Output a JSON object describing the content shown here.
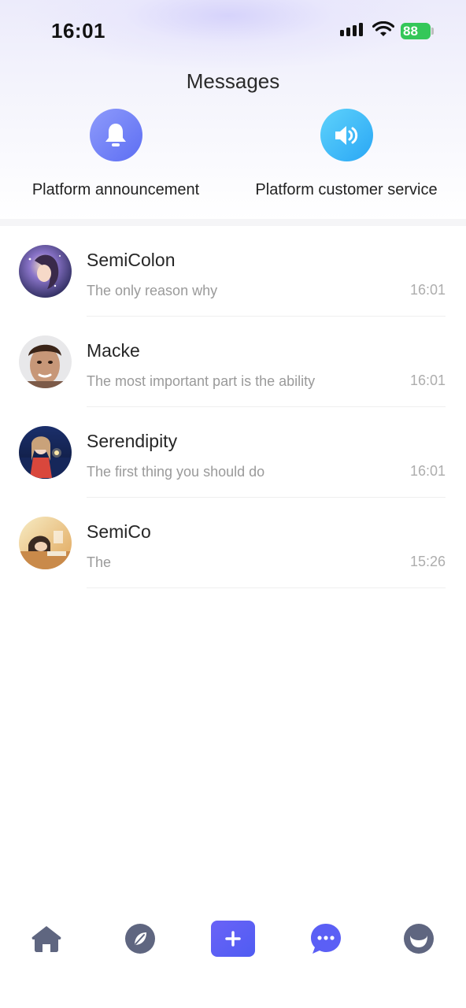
{
  "status": {
    "time": "16:01",
    "battery": "88"
  },
  "header": {
    "title": "Messages"
  },
  "shortcuts": [
    {
      "label": "Platform announcement",
      "icon": "bell-icon",
      "color": "#6a7af5"
    },
    {
      "label": "Platform customer service",
      "icon": "speaker-icon",
      "color": "#3bb7f7"
    }
  ],
  "conversations": [
    {
      "name": "SemiColon",
      "preview": "The only reason why",
      "time": "16:01"
    },
    {
      "name": "Macke",
      "preview": "The most important part is the ability",
      "time": "16:01"
    },
    {
      "name": "Serendipity",
      "preview": "The first thing you should do",
      "time": "16:01"
    },
    {
      "name": "SemiCo",
      "preview": "The",
      "time": "15:26"
    }
  ],
  "tabbar": {
    "items": [
      "home-icon",
      "compass-icon",
      "plus-icon",
      "chat-bubble-icon",
      "profile-icon"
    ],
    "accent": "#5b5ff5",
    "inactive": "#5f6680"
  }
}
